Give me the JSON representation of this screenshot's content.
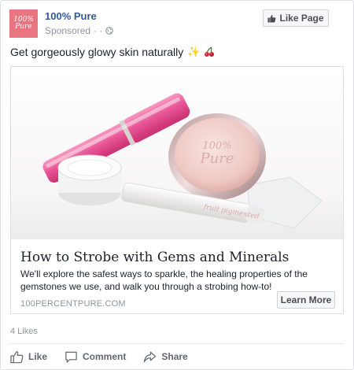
{
  "header": {
    "avatar_text": "100% Pure",
    "page_name": "100% Pure",
    "sponsored": "Sponsored",
    "dots": "· ·",
    "like_page_label": "Like Page"
  },
  "post": {
    "text": "Get gorgeously glowy skin naturally",
    "emojis": [
      "sparkles-icon",
      "cherries-icon"
    ]
  },
  "attachment": {
    "title": "How to Strobe with Gems and Minerals",
    "description": "We'll explore the safest ways to sparkle, the healing properties of the gemstones we use, and walk you through a strobing how-to!",
    "domain": "100PERCENTPURE.COM",
    "cta_label": "Learn More"
  },
  "engagement": {
    "likes": "4 Likes"
  },
  "actions": {
    "like": "Like",
    "comment": "Comment",
    "share": "Share"
  },
  "colors": {
    "brand_link": "#365899",
    "avatar_bg": "#e8757f",
    "muted": "#90949c"
  }
}
